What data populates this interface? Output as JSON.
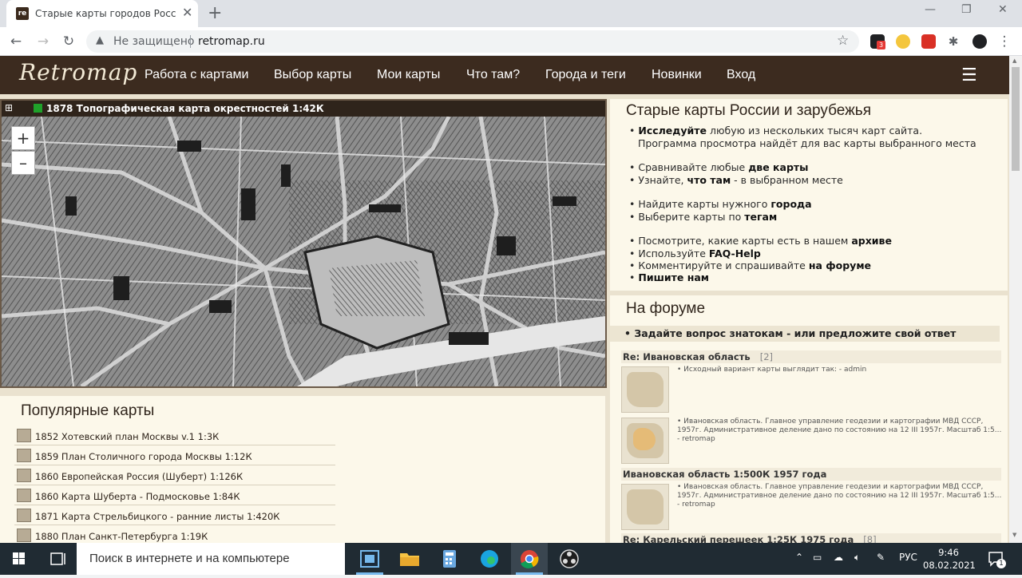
{
  "browser": {
    "tab_title": "Старые карты городов России и зарубежья",
    "favicon_text": "re",
    "security_label": "Не защищено",
    "url": "retromap.ru",
    "extension_badge": "3"
  },
  "site": {
    "logo": "Retromap",
    "nav": [
      "Работа с картами",
      "Выбор карты",
      "Мои карты",
      "Что там?",
      "Города и теги",
      "Новинки",
      "Вход"
    ]
  },
  "map": {
    "title": "1878 Топографическая карта окрестностей 1:42К",
    "zoom_in": "+",
    "zoom_out": "–"
  },
  "popular": {
    "heading": "Популярные карты",
    "items": [
      "1852 Хотевский план Москвы v.1 1:3К",
      "1859 План Столичного города Москвы 1:12К",
      "1860 Европейская Россия (Шуберт) 1:126К",
      "1860 Карта Шуберта - Подмосковье 1:84К",
      "1871 Карта Стрельбицкого - ранние листы 1:420К",
      "1880 План Санкт-Петербурга 1:19К"
    ]
  },
  "info": {
    "heading": "Старые карты России и зарубежья",
    "l1_b": "Исследуйте",
    "l1_t": " любую из нескольких тысяч карт сайта.",
    "l2": "Программа просмотра найдёт для вас карты выбранного места",
    "l3_t": "Сравнивайте любые ",
    "l3_b": "две карты",
    "l4_t": "Узнайте, ",
    "l4_b": "что там",
    "l4_t2": " - в выбранном месте",
    "l5_t": "Найдите карты нужного ",
    "l5_b": "города",
    "l6_t": "Выберите карты по ",
    "l6_b": "тегам",
    "l7_t": "Посмотрите, какие карты есть в нашем ",
    "l7_b": "архиве",
    "l8_t": "Используйте ",
    "l8_b": "FAQ-Help",
    "l9_t": "Комментируйте и спрашивайте ",
    "l9_b": "на форуме",
    "l10_b": "Пишите нам"
  },
  "forum": {
    "heading": "На форуме",
    "ask": "• Задайте вопрос знатокам - или предложите свой ответ",
    "thread1": "Re: Ивановская область",
    "thread1_count": "[2]",
    "post1": "• Исходный вариант карты выглядит так: - admin",
    "post2": "• Ивановская область. Главное управление геодезии и картографии МВД СССР, 1957г. Административное деление дано по состоянию на 12 III 1957г. Масштаб 1:5... - retromap",
    "thread2": "Ивановская область 1:500К 1957 года",
    "post3": "• Ивановская область. Главное управление геодезии и картографии МВД СССР, 1957г. Административное деление дано по состоянию на 12 III 1957г. Масштаб 1:5... - retromap",
    "thread3": "Re: Карельский перешеек 1:25К 1975 года",
    "thread3_count": "[8]"
  },
  "taskbar": {
    "search_placeholder": "Поиск в интернете и на компьютере",
    "lang": "РУС",
    "time": "9:46",
    "date": "08.02.2021",
    "notifications": "1"
  }
}
